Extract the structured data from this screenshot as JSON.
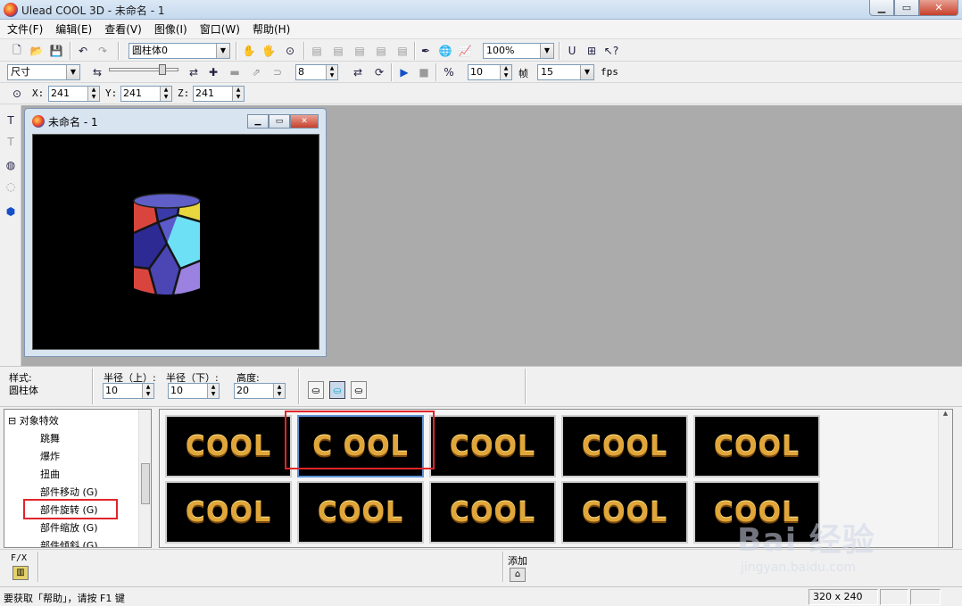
{
  "window": {
    "title": "Ulead COOL 3D - 未命名 - 1"
  },
  "menu": [
    "文件(F)",
    "编辑(E)",
    "查看(V)",
    "图像(I)",
    "窗口(W)",
    "帮助(H)"
  ],
  "toolbar": {
    "object_select": "圆柱体0",
    "zoom": "100%",
    "attribute_select": "尺寸",
    "frames_value": "8",
    "speed_value": "10",
    "frame_label": "帧",
    "fps_value": "15",
    "fps_label": "fps",
    "x_label": "X:",
    "x_value": "241",
    "y_label": "Y:",
    "y_value": "241",
    "z_label": "Z:",
    "z_value": "241"
  },
  "child_window": {
    "title": "未命名 - 1"
  },
  "properties": {
    "style_label": "样式:",
    "style_value": "圆柱体",
    "radius_top_label": "半径（上）:",
    "radius_top_value": "10",
    "radius_bottom_label": "半径（下）:",
    "radius_bottom_value": "10",
    "height_label": "高度:",
    "height_value": "20"
  },
  "effects_tree": {
    "root": "对象特效",
    "items": [
      "跳舞",
      "爆炸",
      "扭曲",
      "部件移动 (G)",
      "部件旋转 (G)",
      "部件缩放 (G)",
      "部件倾斜 (G)"
    ]
  },
  "gallery": {
    "thumb_text": "COOL",
    "thumb_text_variant": "C OOL",
    "selected_index": 1,
    "count": 10
  },
  "bottom": {
    "fx_label": "F/X",
    "add_label": "添加"
  },
  "status": {
    "help_text": "要获取「帮助」，请按 F1 键",
    "size": "320 x 240"
  },
  "watermark": {
    "brand": "Bai 经验",
    "url": "jingyan.baidu.com"
  },
  "colors": {
    "highlight_red": "#e0262a",
    "selection_blue": "#5d95d6",
    "workspace": "#ababab"
  }
}
